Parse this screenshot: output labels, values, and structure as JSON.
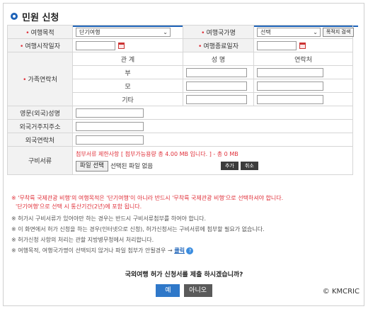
{
  "page": {
    "title": "민원 신청"
  },
  "form": {
    "purpose_label": "여행목적",
    "purpose_value": "단기여행",
    "country_label": "여행국가명",
    "country_value": "선택",
    "country_search_button": "목적지 검색",
    "start_label": "여행시작일자",
    "end_label": "여행종료일자",
    "family_label": "가족연락처",
    "family_headers": {
      "relation": "관 계",
      "name": "성 명",
      "contact": "연락처"
    },
    "family_rows": [
      "부",
      "모",
      "기타"
    ],
    "eng_name_label": "영문(외국)성명",
    "foreign_address_label": "외국거주지주소",
    "foreign_contact_label": "외국연락처",
    "docs_label": "구비서류",
    "docs_limit_text": "첨부서류 제한사항 [ 첨부가능용량 총 4.00 MB 입니다. ]  - 총 0 MB",
    "add_button": "추가",
    "cancel_button": "취소",
    "file_button": "파일 선택",
    "file_status": "선택된 파일 없음"
  },
  "notes": {
    "red_1": "※ '무착륙 국제관광 비행'의 여행목적은 '단기여행'이 아니라 반드시 '무착륙 국제관광 비행'으로 선택하셔야 합니다.",
    "red_2": "'단기여행'으로 선택 시 통산기간(2년)에 포함 됩니다.",
    "gray_1": "※ 허가시 구비서류가 있어야만 하는 경우는 반드시 구비서류첨부를 하여야 합니다.",
    "gray_2": "※ 이 화면에서 허가 신청을 하는 경우(인터넷으로 신청), 허가신청서는 구비서류에 첨부할 필요가 없습니다.",
    "gray_3": "※ 허가신청 사항의 처리는 관할 지방병무청에서 처리합니다.",
    "gray_4": "※ 여행목적, 여행국가명이 선택되지 않거나 파일 첨부가 안될경우 →",
    "click_link": "클릭",
    "help_icon_char": "?"
  },
  "confirm": {
    "question": "국외여행 허가 신청서를 제출 하시겠습니까?",
    "yes": "예",
    "no": "아니오"
  },
  "footer": {
    "copyright": "© KMCRIC"
  },
  "colors": {
    "accent": "#1e63b8",
    "required": "#e0303a",
    "yes_button": "#2f78c9",
    "no_button": "#5a5a5a"
  }
}
